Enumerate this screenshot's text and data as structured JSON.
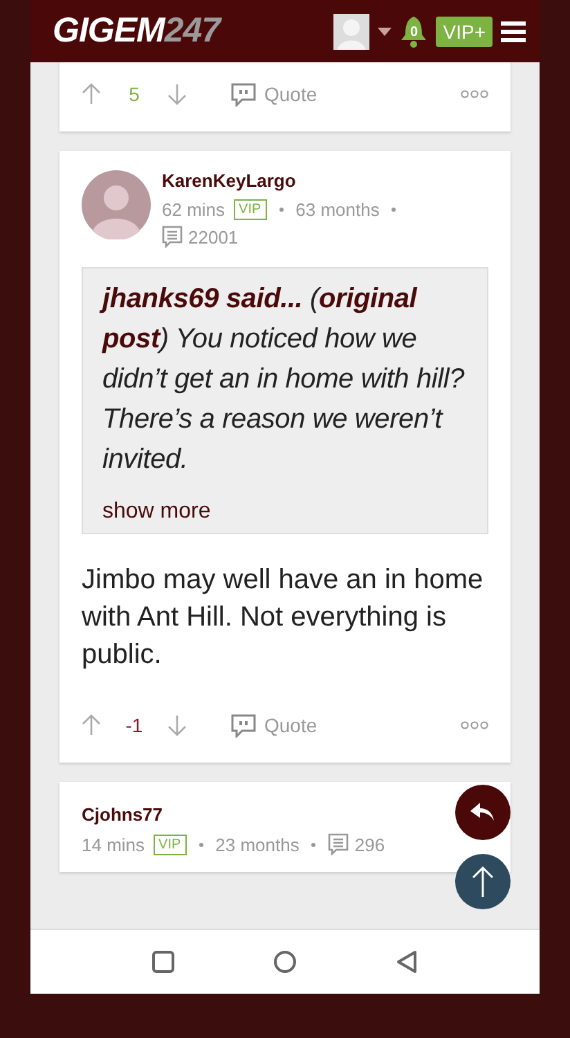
{
  "header": {
    "logo_main": "GIGEM",
    "logo_number": "247",
    "notifications": "0",
    "vip_button": "VIP+"
  },
  "posts": [
    {
      "kind": "tail",
      "score": "5",
      "color": "#7cb342",
      "quote_label": "Quote"
    },
    {
      "kind": "full",
      "author": "KarenKeyLargo",
      "time": "62 mins",
      "badge": "VIP",
      "tenure": "63 months",
      "post_count": "22001",
      "quote": "**jhanks69 said...** (**original post**) You noticed how we didn’t get an in home with hill? There’s a reason we weren’t invited.",
      "show_more": "show more",
      "body": "Jimbo may well have an in home with Ant Hill. Not everything is public.",
      "score": "-1",
      "color": "#8b1a2b",
      "quote_label": "Quote"
    },
    {
      "kind": "head",
      "author": "Cjohns77",
      "time": "14 mins",
      "badge": "VIP",
      "tenure": "23 months",
      "post_count": "296"
    }
  ]
}
